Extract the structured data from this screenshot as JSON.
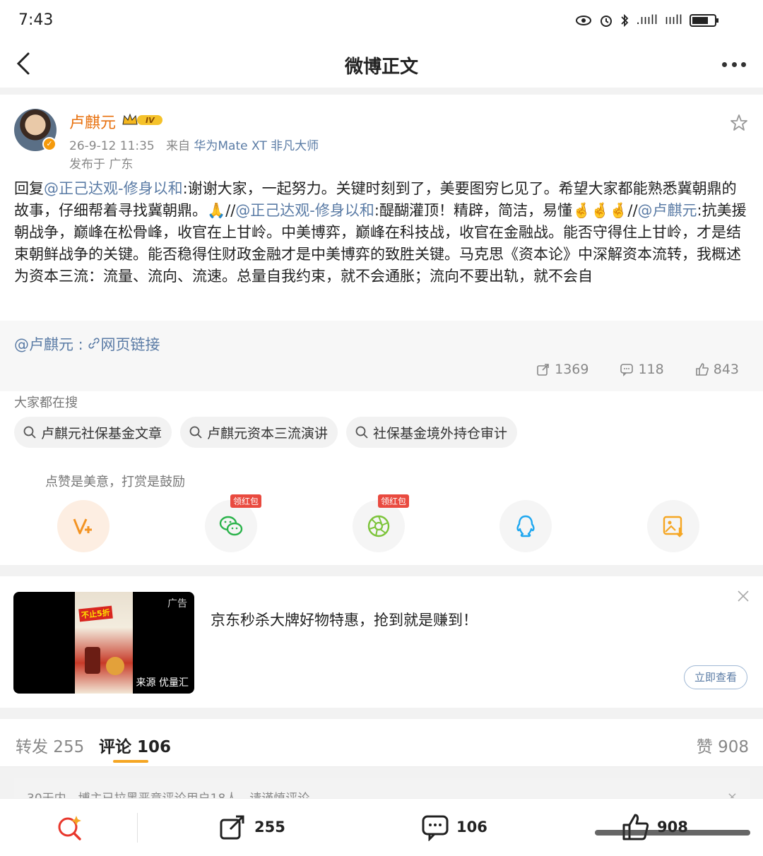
{
  "status_bar": {
    "time": "7:43",
    "signal_1": ".ıııll",
    "signal_2": "ıııll"
  },
  "navbar": {
    "title": "微博正文"
  },
  "post": {
    "username": "卢麒元",
    "level_badge": "IV",
    "time": "26-9-12 11:35",
    "source_prefix": "来自",
    "device": "华为Mate XT 非凡大师",
    "location": "发布于 广东",
    "content": {
      "p1": "回复",
      "at1": "@正己达观-修身以和",
      "p2": ":谢谢大家，一起努力。关键时刻到了，美要图穷匕见了。希望大家都能熟悉冀朝鼎的故事，仔细帮着寻找冀朝鼎。🙏//",
      "at2": "@正己达观-修身以和",
      "p3": ":醍醐灌顶！精辟，简洁，易懂🤞🤞🤞//",
      "at3": "@卢麒元",
      "p4": ":抗美援朝战争，巅峰在松骨峰，收官在上甘岭。中美博弈，巅峰在科技战，收官在金融战。能否守得住上甘岭，才是结束朝鲜战争的关键。能否稳得住财政金融才是中美博弈的致胜关键。马克思《资本论》中深解资本流转，我概述为资本三流：流量、流向、流速。总量自我约束，就不会通胀；流向不要出轨，就不会自"
    },
    "repost_link": {
      "at": "@卢麒元",
      "sep": " :",
      "link_label": "网页链接"
    },
    "stats": {
      "reposts": "1369",
      "comments": "118",
      "likes": "843"
    }
  },
  "hot_search": {
    "title": "大家都在搜",
    "chips": [
      "卢麒元社保基金文章",
      "卢麒元资本三流演讲",
      "社保基金境外持仓审计"
    ]
  },
  "reward": {
    "tip": "点赞是美意，打赏是鼓励",
    "redbag_label": "领红包"
  },
  "ad": {
    "tag": "广告",
    "source": "来源 优量汇",
    "poster_text": "不止5折",
    "text": "京东秒杀大牌好物特惠，抢到就是赚到！",
    "button": "立即查看"
  },
  "tabs": {
    "repost": "转发 255",
    "comment": "评论 106",
    "like": "赞 908"
  },
  "notice": {
    "text": "30天内，博主已拉黑恶意评论用户18人，请谨慎评论",
    "close": "×"
  },
  "bottom_bar": {
    "repost_count": "255",
    "comment_count": "106",
    "like_count": "908"
  },
  "colors": {
    "accent_orange": "#e8710f",
    "link_blue": "#5a7ba5",
    "tab_underline": "#f5a623",
    "wechat_green": "#2bb34b",
    "moments_green": "#7cc43a",
    "qq_blue": "#1ea7f0",
    "save_orange": "#f5a623"
  }
}
